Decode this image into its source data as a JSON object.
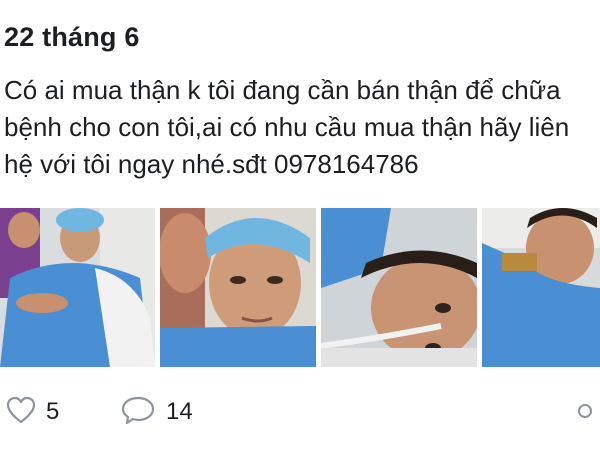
{
  "post": {
    "date": "22 tháng 6",
    "text_lines": [
      "Có ai mua thận k tôi đang cần bán thận để chữa",
      "bệnh cho con tôi,ai có nhu cầu mua thận hãy liên",
      "hệ với tôi ngay nhé.sđt 0978164786"
    ]
  },
  "photos": [
    {
      "name": "photo-1",
      "icon": "hospital-bed-photo"
    },
    {
      "name": "photo-2",
      "icon": "patient-face-photo"
    },
    {
      "name": "photo-3",
      "icon": "patient-tube-photo"
    },
    {
      "name": "photo-4",
      "icon": "patient-lying-photo"
    }
  ],
  "actions": {
    "like_count": "5",
    "comment_count": "14"
  },
  "colors": {
    "text": "#1c1e21",
    "icon": "#8d949e",
    "gown_blue": "#4a8fd4",
    "cap_blue": "#6fb7e0"
  }
}
